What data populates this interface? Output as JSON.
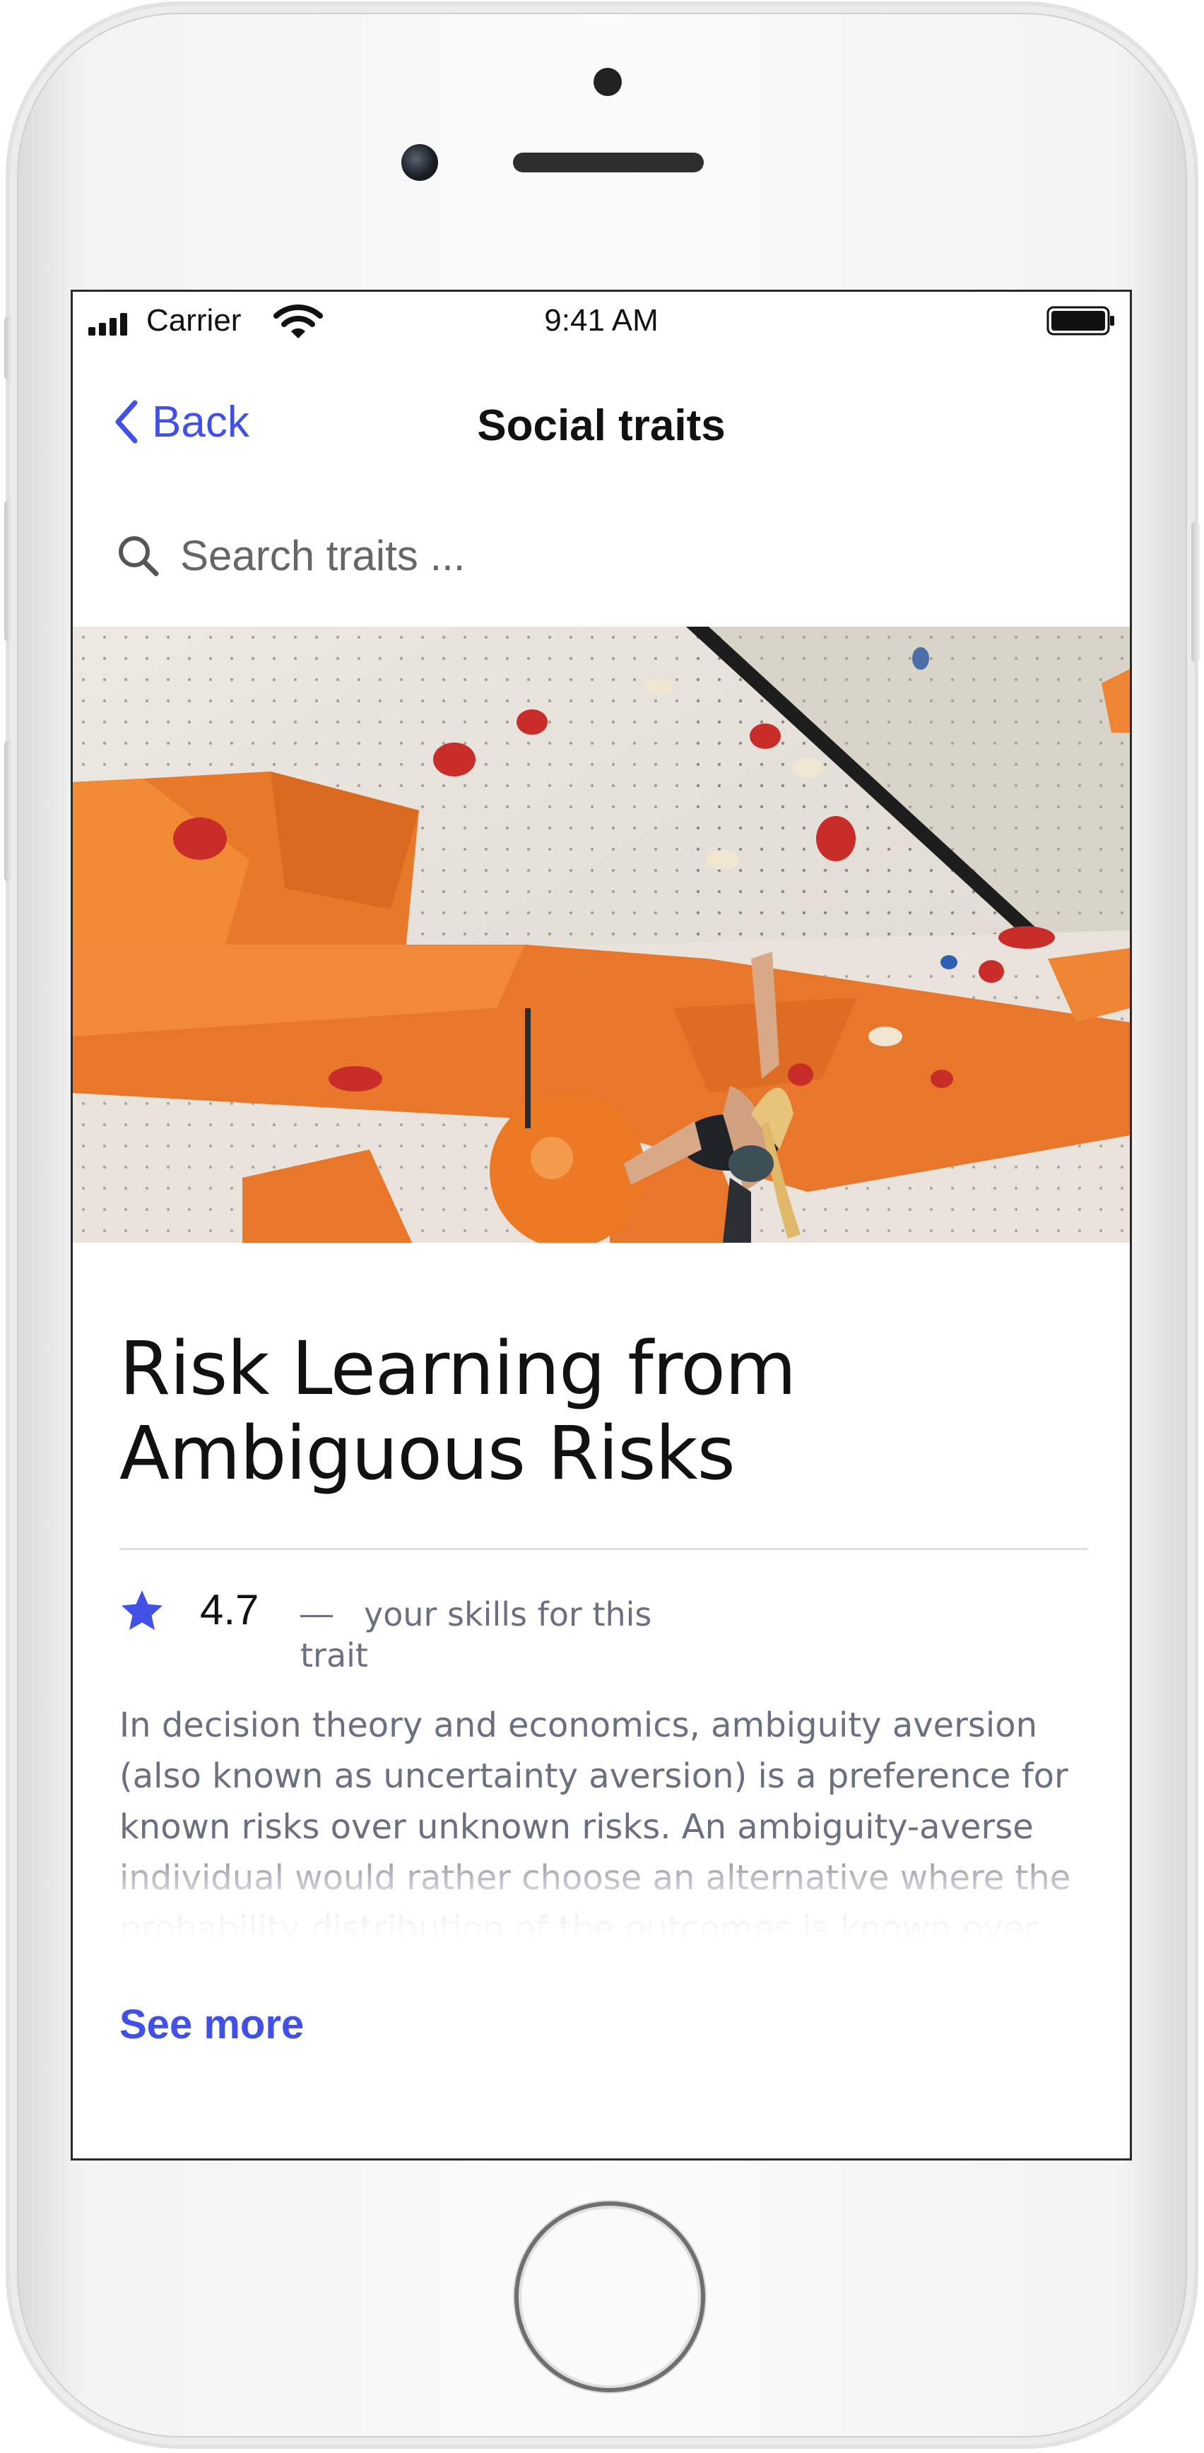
{
  "status_bar": {
    "carrier": "Carrier",
    "time": "9:41 AM"
  },
  "nav": {
    "back_label": "Back",
    "title": "Social traits"
  },
  "search": {
    "placeholder": "Search traits ..."
  },
  "trait": {
    "title": "Risk Learning from Ambiguous Risks",
    "rating": "4.7",
    "rating_dash": "—",
    "rating_caption": "your skills for this trait",
    "description": "In decision theory and economics, ambiguity aversion (also known as uncertainty aversion) is a preference for known risks over unknown risks. An ambiguity-averse individual would rather choose an alternative where the probability distribution of the outcomes is known over one where the probabilities are unknown.",
    "see_more_label": "See more"
  },
  "colors": {
    "accent": "#4150e6",
    "text_primary": "#111111",
    "text_secondary": "#6b7080",
    "divider": "#dedede"
  },
  "icons": {
    "back": "chevron-left-icon",
    "search": "search-icon",
    "rating": "star-icon"
  }
}
